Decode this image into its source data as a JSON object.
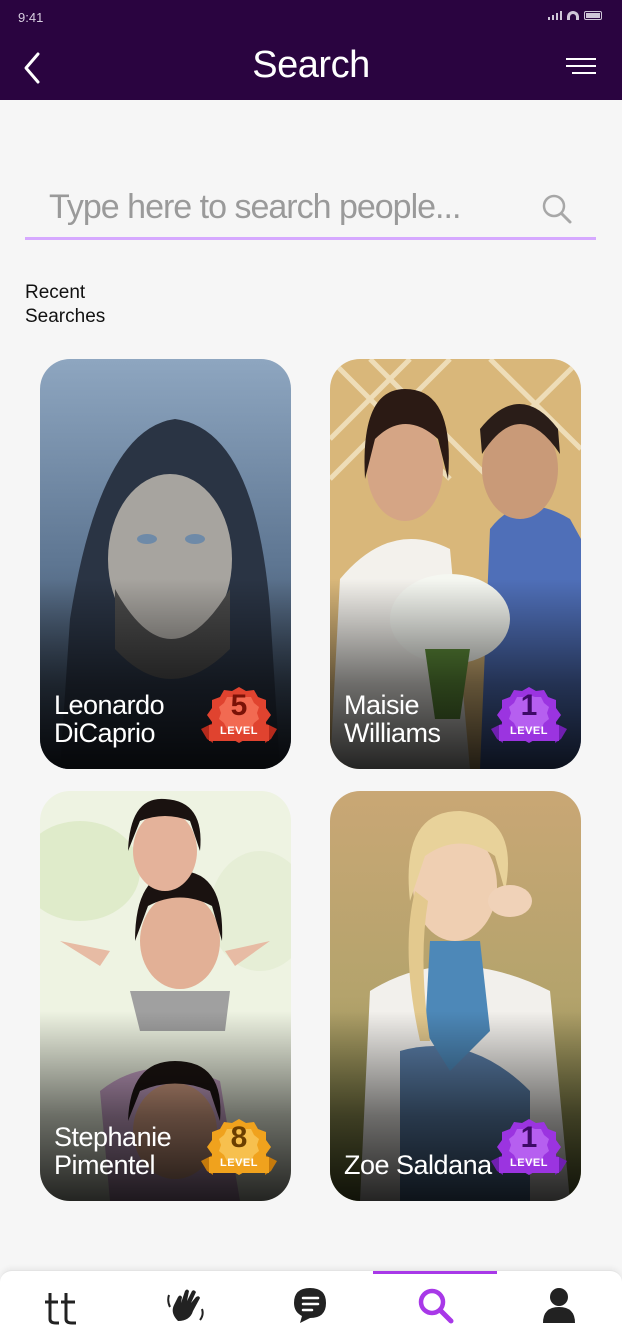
{
  "status_bar": {
    "time": "9:41"
  },
  "header": {
    "title": "Search"
  },
  "search": {
    "placeholder": "Type here to search people..."
  },
  "recent": {
    "title": "Recent Searches",
    "people": [
      {
        "name": "Leonardo DiCaprio",
        "level": "5",
        "level_label": "LEVEL",
        "badge_color": "#e0432f"
      },
      {
        "name": "Maisie Williams",
        "level": "1",
        "level_label": "LEVEL",
        "badge_color": "#9b34e0"
      },
      {
        "name": "Stephanie Pimentel",
        "level": "8",
        "level_label": "LEVEL",
        "badge_color": "#f0a21d"
      },
      {
        "name": "Zoe Saldana",
        "level": "1",
        "level_label": "LEVEL",
        "badge_color": "#9b34e0"
      }
    ]
  },
  "tabbar": {
    "tabs": [
      {
        "icon": "tt-logo-icon",
        "active": false
      },
      {
        "icon": "wave-hand-icon",
        "active": false
      },
      {
        "icon": "chat-bubble-icon",
        "active": false
      },
      {
        "icon": "search-icon",
        "active": true
      },
      {
        "icon": "profile-icon",
        "active": false
      }
    ]
  },
  "colors": {
    "header_bg": "#2a0440",
    "accent": "#a838e8",
    "search_underline": "#d6a9ff"
  }
}
